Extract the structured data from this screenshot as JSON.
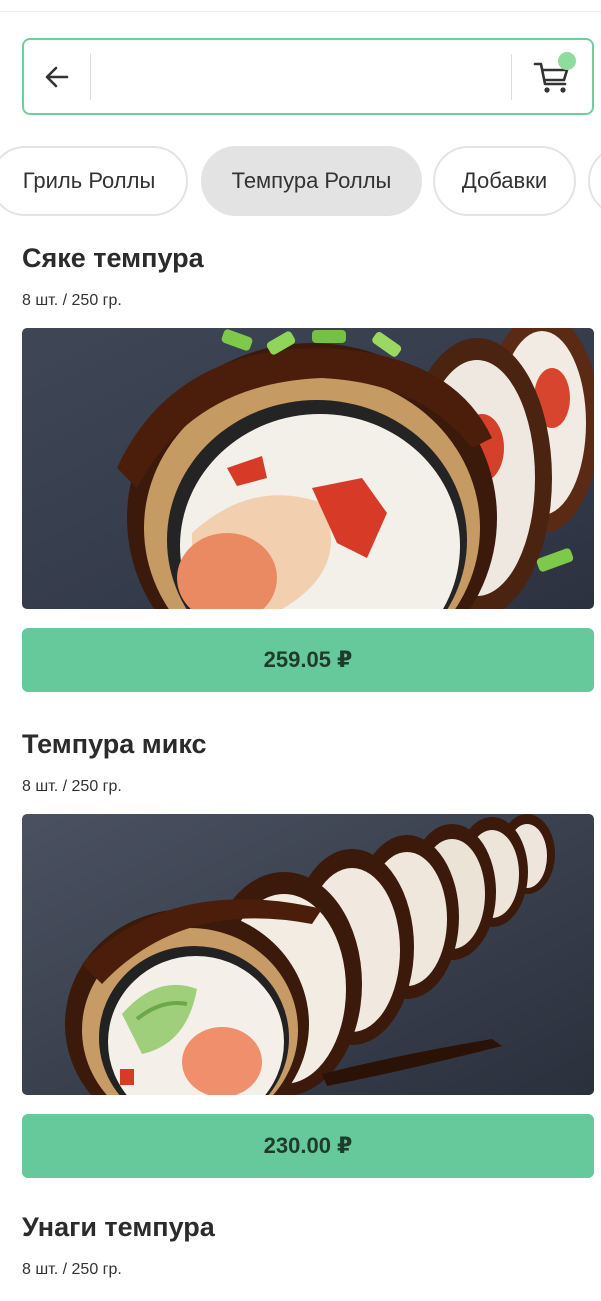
{
  "header": {
    "search_value": "",
    "cart_has_items": true
  },
  "categories": [
    {
      "label": "Гриль Роллы",
      "active": false
    },
    {
      "label": "Темпура Роллы",
      "active": true
    },
    {
      "label": "Добавки",
      "active": false
    }
  ],
  "products": [
    {
      "title": "Сяке темпура",
      "meta": "8 шт. / 250 гр.",
      "price": "259.05 ₽"
    },
    {
      "title": "Темпура микс",
      "meta": "8 шт. / 250 гр.",
      "price": "230.00 ₽"
    },
    {
      "title": "Унаги темпура",
      "meta": "8 шт. / 250 гр."
    }
  ],
  "colors": {
    "accent": "#66c99b",
    "search_border": "#6fcf9c",
    "cart_dot": "#8fdc9f",
    "active_tab": "#e3e3e3"
  }
}
